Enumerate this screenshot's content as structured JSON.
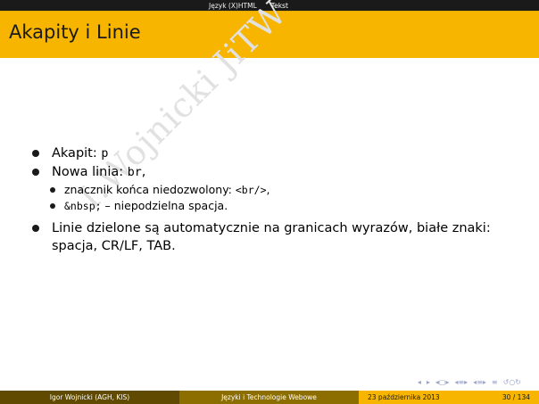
{
  "header": {
    "nav_items": [
      "Język (X)HTML",
      "Tekst"
    ]
  },
  "slide": {
    "title": "Akapity i Linie",
    "watermark": "I.Wojnicki  JiTW",
    "bullets": {
      "b1_text": "Akapit: ",
      "b1_code": "p",
      "b2_text": "Nowa linia: ",
      "b2_code": "br",
      "b2_suffix": ",",
      "sub1_text": "znacznik końca niedozwolony: ",
      "sub1_code": "<br/>",
      "sub1_suffix": ",",
      "sub2_code": "&nbsp;",
      "sub2_text": " – niepodzielna spacja.",
      "b3_text": "Linie dzielone są automatycznie na granicach wyrazów, białe znaki: spacja, CR/LF, TAB."
    }
  },
  "footer": {
    "author": "Igor Wojnicki  (AGH, KIS)",
    "course": "Języki i Technologie Webowe",
    "date": "23 października 2013",
    "page": "30 / 134"
  },
  "icons": [
    "nav-first-icon",
    "nav-prev-icon",
    "nav-frame-icon",
    "nav-next-icon",
    "nav-section-icon",
    "nav-subsection-icon",
    "nav-align-icon",
    "nav-search-icon"
  ]
}
